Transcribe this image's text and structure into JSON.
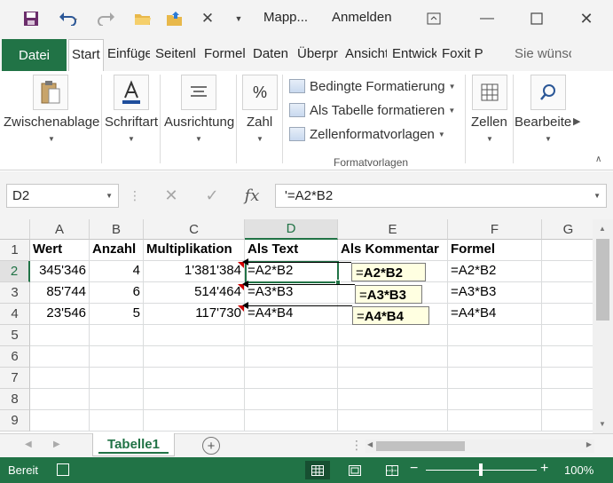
{
  "titlebar": {
    "doc_title": "Mapp...",
    "signin": "Anmelden",
    "save_icon": "save-icon",
    "undo_icon": "undo-icon",
    "redo_icon": "redo-icon"
  },
  "ribbon_tabs": {
    "file": "Datei",
    "tabs": [
      "Start",
      "Einfüge",
      "Seitenl",
      "Formel",
      "Daten",
      "Überpr",
      "Ansicht",
      "Entwick",
      "Foxit P"
    ],
    "tell_me": "Sie wünsc"
  },
  "ribbon": {
    "groups": [
      "Zwischenablage",
      "Schriftart",
      "Ausrichtung",
      "Zahl"
    ],
    "styles": [
      "Bedingte Formatierung",
      "Als Tabelle formatieren",
      "Zellenformatvorlagen"
    ],
    "styles_caption": "Formatvorlagen",
    "cells": "Zellen",
    "editing": "Bearbeite",
    "number_symbol": "%"
  },
  "formula_bar": {
    "name_box": "D2",
    "formula": "'=A2*B2",
    "fx": "fx"
  },
  "grid": {
    "columns": [
      "A",
      "B",
      "C",
      "D",
      "E",
      "F",
      "G"
    ],
    "rows": [
      "1",
      "2",
      "3",
      "4",
      "5",
      "6",
      "7",
      "8",
      "9"
    ],
    "headers": [
      "Wert",
      "Anzahl",
      "Multiplikation",
      "Als Text",
      "Als Kommentar",
      "Formel"
    ],
    "data": [
      [
        "345'346",
        "4",
        "1'381'384",
        "=A2*B2",
        "",
        "=A2*B2"
      ],
      [
        "85'744",
        "6",
        "514'464",
        "=A3*B3",
        "",
        "=A3*B3"
      ],
      [
        "23'546",
        "5",
        "117'730",
        "=A4*B4",
        "",
        "=A4*B4"
      ]
    ],
    "comments": [
      {
        "prefix": "=",
        "bold": "A2*B2"
      },
      {
        "prefix": "=",
        "bold": "A3*B3"
      },
      {
        "prefix": "=",
        "bold": "A4*B4"
      }
    ],
    "selected_cell": "D2"
  },
  "sheets": {
    "active": "Tabelle1",
    "add": "+"
  },
  "status": {
    "text": "Bereit",
    "zoom": "100%",
    "zoom_minus": "−",
    "zoom_plus": "+"
  },
  "colors": {
    "excel_green": "#217346",
    "comment_bg": "#ffffe1",
    "comment_indicator": "#d00000"
  }
}
